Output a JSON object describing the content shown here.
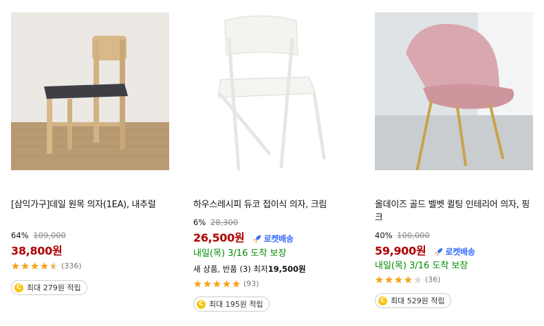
{
  "products": [
    {
      "name": "[삼익가구]데일 원목 의자(1EA), 내추럴",
      "discount": "64%",
      "original_price": "109,000",
      "price": "38,800원",
      "rating": 4.5,
      "reviews": "(336)",
      "reward": "최대 279원 적립"
    },
    {
      "name": "하우스레시피 듀코 접이식 의자, 크림",
      "discount": "6%",
      "original_price": "28,300",
      "price": "26,500원",
      "rocket": "로켓배송",
      "delivery": "내일(목) 3/16 도착 보장",
      "used_offer": "새 상품, 반품 (3) 최저",
      "used_price": "19,500원",
      "rating": 5,
      "reviews": "(93)",
      "reward": "최대 195원 적립"
    },
    {
      "name": "올데이즈 골드 벨벳 퀼팅 인테리어 의자, 핑크",
      "discount": "40%",
      "original_price": "100,000",
      "price": "59,900원",
      "rocket": "로켓배송",
      "delivery": "내일(목) 3/16 도착 보장",
      "rating": 4,
      "reviews": "(36)",
      "reward": "최대 529원 적립"
    }
  ],
  "colors": {
    "price": "#ae0000",
    "rocket": "#346aff",
    "delivery": "#008c00",
    "star": "#f5a623"
  },
  "coin_symbol": "C"
}
